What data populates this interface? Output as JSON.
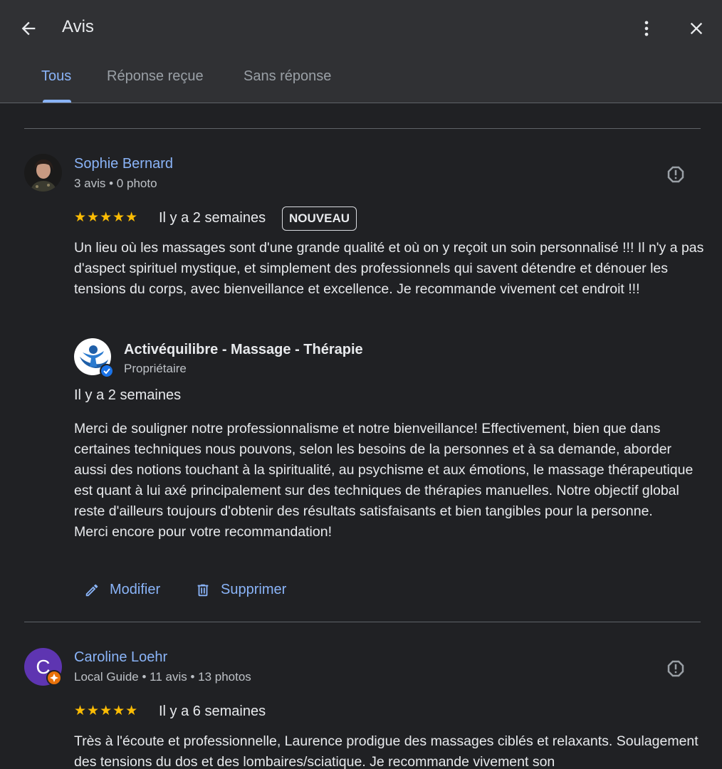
{
  "header": {
    "title": "Avis",
    "back_icon": "arrow-back-icon",
    "more_icon": "more-vert-icon",
    "close_icon": "close-icon"
  },
  "tabs": [
    {
      "label": "Tous",
      "active": true
    },
    {
      "label": "Réponse reçue",
      "active": false
    },
    {
      "label": "Sans réponse",
      "active": false
    }
  ],
  "colors": {
    "accent": "#8ab4f8",
    "star": "#fbbc04",
    "background": "#202124",
    "header": "#303134"
  },
  "reviews": [
    {
      "name": "Sophie Bernard",
      "meta": "3 avis • 0 photo",
      "rating": 5,
      "stars": "★★★★★",
      "date": "Il y a 2 semaines",
      "badge": "NOUVEAU",
      "text": "Un lieu où les massages sont d'une grande qualité et où on y reçoit un soin personnalisé !!! Il n'y a pas d'aspect spirituel mystique, et simplement des professionnels qui savent détendre et dénouer les tensions du corps, avec bienveillance et excellence. Je recommande vivement cet endroit !!!",
      "reply": {
        "owner_name": "Activéquilibre - Massage - Thérapie",
        "owner_role": "Propriétaire",
        "date": "Il y a 2 semaines",
        "text": "Merci de souligner notre professionnalisme et notre bienveillance! Effectivement, bien que dans certaines techniques nous pouvons, selon les besoins de la personnes et à sa demande, aborder aussi des notions touchant à la spiritualité, au psychisme et aux émotions, le massage thérapeutique est quant à lui axé principalement sur des techniques de thérapies manuelles. Notre objectif global reste d'ailleurs toujours d'obtenir des résultats satisfaisants et bien tangibles pour la personne.\nMerci encore pour votre recommandation!"
      },
      "actions": {
        "edit_label": "Modifier",
        "delete_label": "Supprimer"
      }
    },
    {
      "name": "Caroline Loehr",
      "avatar_letter": "C",
      "meta": "Local Guide • 11 avis • 13 photos",
      "rating": 5,
      "stars": "★★★★★",
      "date": "Il y a 6 semaines",
      "text": "Très à l'écoute et professionnelle, Laurence prodigue des massages ciblés et relaxants. Soulagement des tensions du dos et des lombaires/sciatique. Je recommande vivement son"
    }
  ]
}
